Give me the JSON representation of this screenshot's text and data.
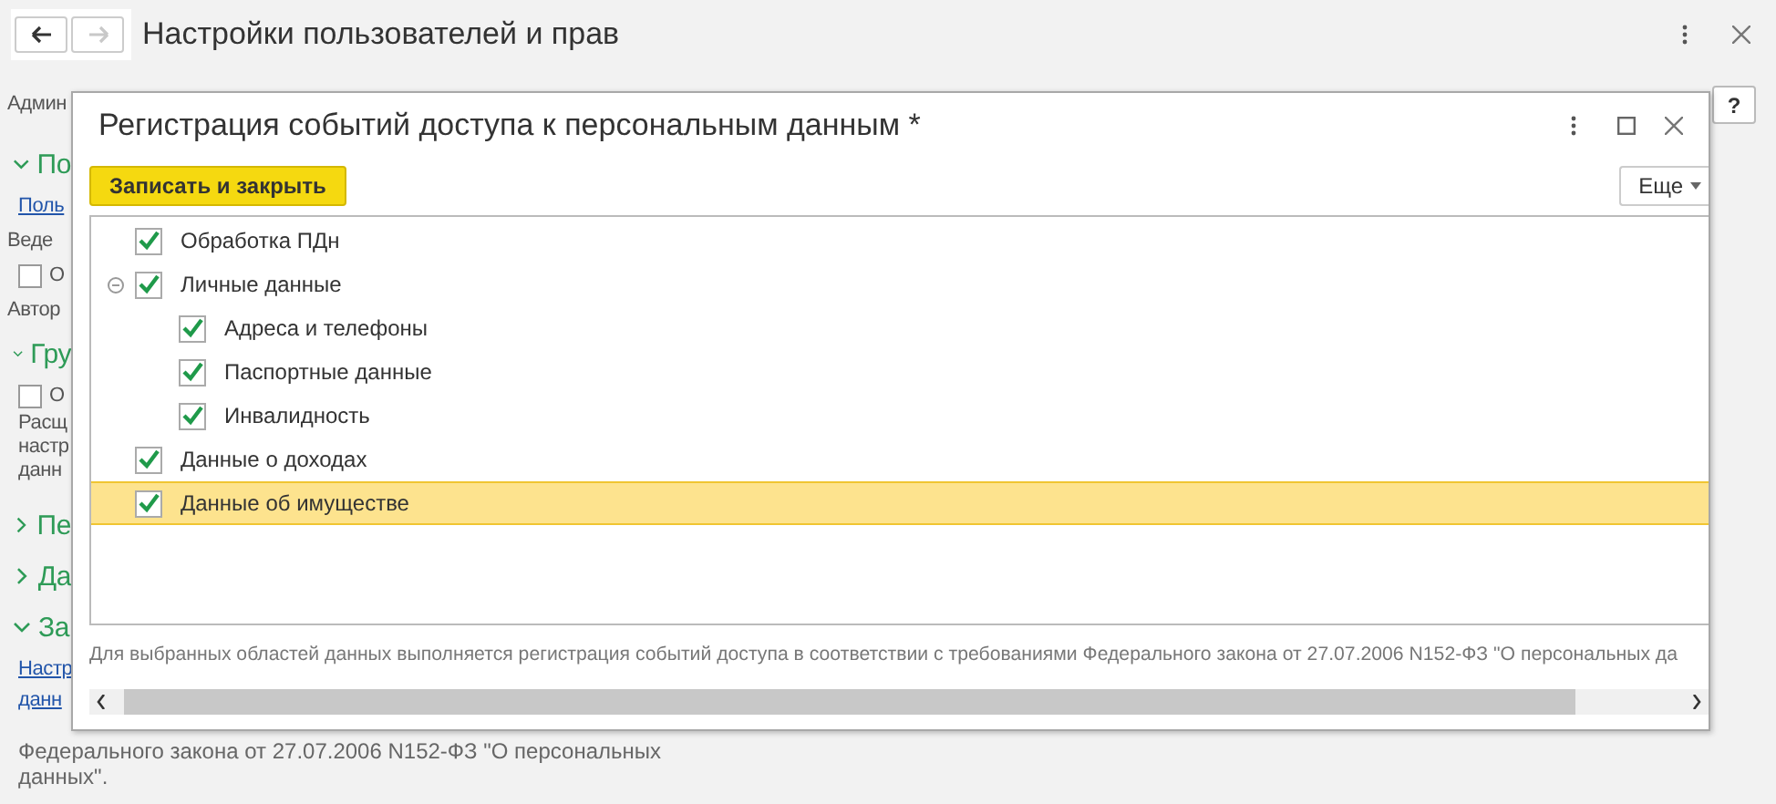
{
  "window": {
    "title": "Настройки пользователей и прав",
    "back_disabled": false,
    "forward_disabled": true
  },
  "help_button": "?",
  "left_items": [
    {
      "kind": "label",
      "text": "Админ"
    },
    {
      "kind": "section",
      "text": "По",
      "expanded": true
    },
    {
      "kind": "link",
      "text": "Поль"
    },
    {
      "kind": "label",
      "text": "Веде"
    },
    {
      "kind": "checkbox",
      "text": "О",
      "checked": false
    },
    {
      "kind": "label",
      "text": "Автор"
    },
    {
      "kind": "section",
      "text": "Гру",
      "expanded": true
    },
    {
      "kind": "checkbox",
      "text": "О",
      "checked": false
    },
    {
      "kind": "note",
      "text": "Расщ"
    },
    {
      "kind": "note",
      "text": "настр"
    },
    {
      "kind": "note",
      "text": "данн"
    },
    {
      "kind": "section",
      "text": "Пе",
      "expanded": false
    },
    {
      "kind": "section",
      "text": "Да",
      "expanded": false
    },
    {
      "kind": "section",
      "text": "За",
      "expanded": true
    },
    {
      "kind": "link",
      "text": "Настр"
    },
    {
      "kind": "link",
      "text": "данн"
    }
  ],
  "footer_left": [
    "Федерального закона от 27.07.2006 N152-ФЗ \"О персональных",
    "данных\"."
  ],
  "dialog": {
    "title": "Регистрация событий доступа к персональным данным *",
    "save_button": "Записать и закрыть",
    "more_button": "Еще",
    "tree": [
      {
        "label": "Обработка ПДн",
        "checked": true,
        "selected": false
      },
      {
        "label": "Личные данные",
        "checked": true,
        "selected": false,
        "expanded": true,
        "children": [
          {
            "label": "Адреса и телефоны",
            "checked": true,
            "selected": false
          },
          {
            "label": "Паспортные данные",
            "checked": true,
            "selected": false
          },
          {
            "label": "Инвалидность",
            "checked": true,
            "selected": false
          }
        ]
      },
      {
        "label": "Данные о доходах",
        "checked": true,
        "selected": false
      },
      {
        "label": "Данные об имуществе",
        "checked": true,
        "selected": true
      }
    ],
    "description": "Для выбранных областей данных выполняется регистрация событий доступа в соответствии с требованиями Федерального закона от 27.07.2006 N152-ФЗ \"О персональных да"
  }
}
